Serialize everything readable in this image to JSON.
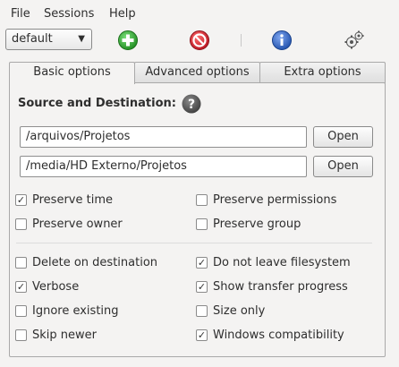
{
  "menubar": {
    "items": [
      "File",
      "Sessions",
      "Help"
    ]
  },
  "toolbar": {
    "session_value": "default",
    "buttons": [
      "add-icon",
      "remove-icon",
      "info-icon",
      "settings-icon"
    ]
  },
  "tabs": [
    {
      "label": "Basic options",
      "active": true
    },
    {
      "label": "Advanced options",
      "active": false
    },
    {
      "label": "Extra options",
      "active": false
    }
  ],
  "basic": {
    "section_title": "Source and Destination:",
    "source_path": "/arquivos/Projetos",
    "destination_path": "/media/HD Externo/Projetos",
    "open_label": "Open",
    "options": [
      {
        "label": "Preserve time",
        "checked": true
      },
      {
        "label": "Preserve permissions",
        "checked": false
      },
      {
        "label": "Preserve owner",
        "checked": false
      },
      {
        "label": "Preserve group",
        "checked": false
      },
      {
        "label": "Delete on destination",
        "checked": false
      },
      {
        "label": "Do not leave filesystem",
        "checked": true
      },
      {
        "label": "Verbose",
        "checked": true
      },
      {
        "label": "Show transfer progress",
        "checked": true
      },
      {
        "label": "Ignore existing",
        "checked": false
      },
      {
        "label": "Size only",
        "checked": false
      },
      {
        "label": "Skip newer",
        "checked": false
      },
      {
        "label": "Windows compatibility",
        "checked": true
      }
    ]
  },
  "colors": {
    "add": "#2e9b2e",
    "remove": "#d0202a",
    "info": "#2a5fc0",
    "help": "#555555"
  }
}
